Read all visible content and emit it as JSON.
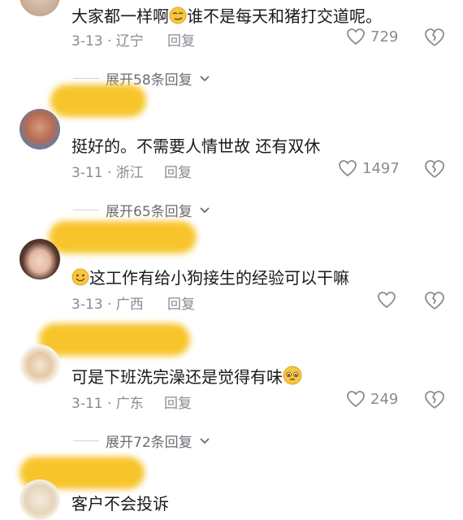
{
  "comments": [
    {
      "text": "大家都一样啊",
      "text_after_emoji": "谁不是每天和猪打交道呢。",
      "date_location": "3-13 · 辽宁",
      "reply_label": "回复",
      "likes": "729"
    },
    {
      "text": "挺好的。不需要人情世故 还有双休",
      "date_location": "3-11 · 浙江",
      "reply_label": "回复",
      "likes": "1497"
    },
    {
      "text_after_emoji": "这工作有给小狗接生的经验可以干嘛",
      "date_location": "3-13 · 广西",
      "reply_label": "回复",
      "likes": ""
    },
    {
      "text": "可是下班洗完澡还是觉得有味",
      "date_location": "3-11 · 广东",
      "reply_label": "回复",
      "likes": "249"
    },
    {
      "text": "客户不会投诉"
    }
  ],
  "expanders": [
    "展开58条回复",
    "展开65条回复",
    "展开72条回复"
  ],
  "colors": {
    "redaction": "#f7c52b",
    "meta_gray": "#8a8b91"
  }
}
